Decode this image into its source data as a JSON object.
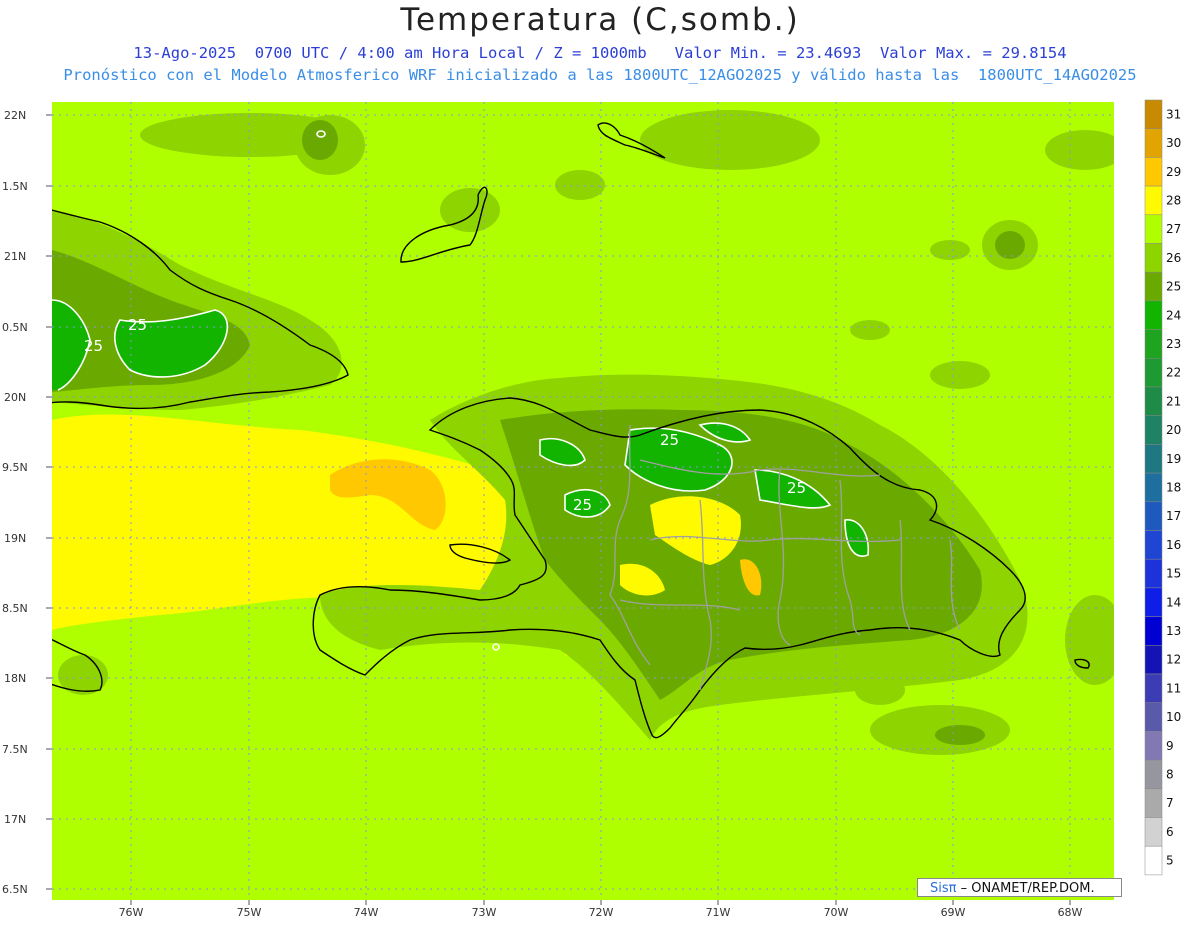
{
  "title": "Temperatura (C,somb.)",
  "subtitle1": "13-Ago-2025  0700 UTC / 4:00 am Hora Local / Z = 1000mb   Valor Min. = 23.4693  Valor Max. = 29.8154",
  "subtitle2": "Pronóstico con el Modelo Atmosferico WRF inicializado a las 1800UTC_12AGO2025 y válido hasta las  1800UTC_14AGO2025",
  "credit": {
    "brand": "Sisπ",
    "org": "– ONAMET/REP.DOM."
  },
  "lat_ticks": [
    "22N",
    "1.5N",
    "21N",
    "0.5N",
    "20N",
    "9.5N",
    "19N",
    "8.5N",
    "18N",
    "7.5N",
    "17N",
    "6.5N"
  ],
  "lon_ticks": [
    "76W",
    "75W",
    "74W",
    "73W",
    "72W",
    "71W",
    "70W",
    "69W",
    "68W"
  ],
  "contour_labels": [
    "25",
    "25",
    "25",
    "25",
    "25"
  ],
  "legend": {
    "labels": [
      "31",
      "30",
      "29",
      "28",
      "27",
      "26",
      "25",
      "24",
      "23",
      "22",
      "21",
      "20",
      "19",
      "18",
      "17",
      "16",
      "15",
      "14",
      "13",
      "12",
      "11",
      "10",
      "9",
      "8",
      "7",
      "6",
      "5"
    ],
    "colors": [
      "#c88a00",
      "#e2a400",
      "#ffc800",
      "#fffa00",
      "#b0ff00",
      "#8ed400",
      "#6aaa00",
      "#12b400",
      "#1ea41e",
      "#1e9a32",
      "#1e8c46",
      "#1e8264",
      "#1e7882",
      "#1e6ea0",
      "#1e5abe",
      "#1e46d2",
      "#1e32dc",
      "#0f1ee6",
      "#0000d2",
      "#1414b4",
      "#3c3cb4",
      "#5a5aaa",
      "#8278b4",
      "#9696a0",
      "#aaaaaa",
      "#d2d2d2",
      "#ffffff"
    ]
  },
  "colors": {
    "sea_base": "#b0ff00",
    "warm": "#fffa00",
    "warmer": "#ffc800",
    "level26": "#8ed400",
    "level25": "#6aaa00",
    "level24": "#12b400",
    "coast": "#000000",
    "borders": "#999999"
  }
}
